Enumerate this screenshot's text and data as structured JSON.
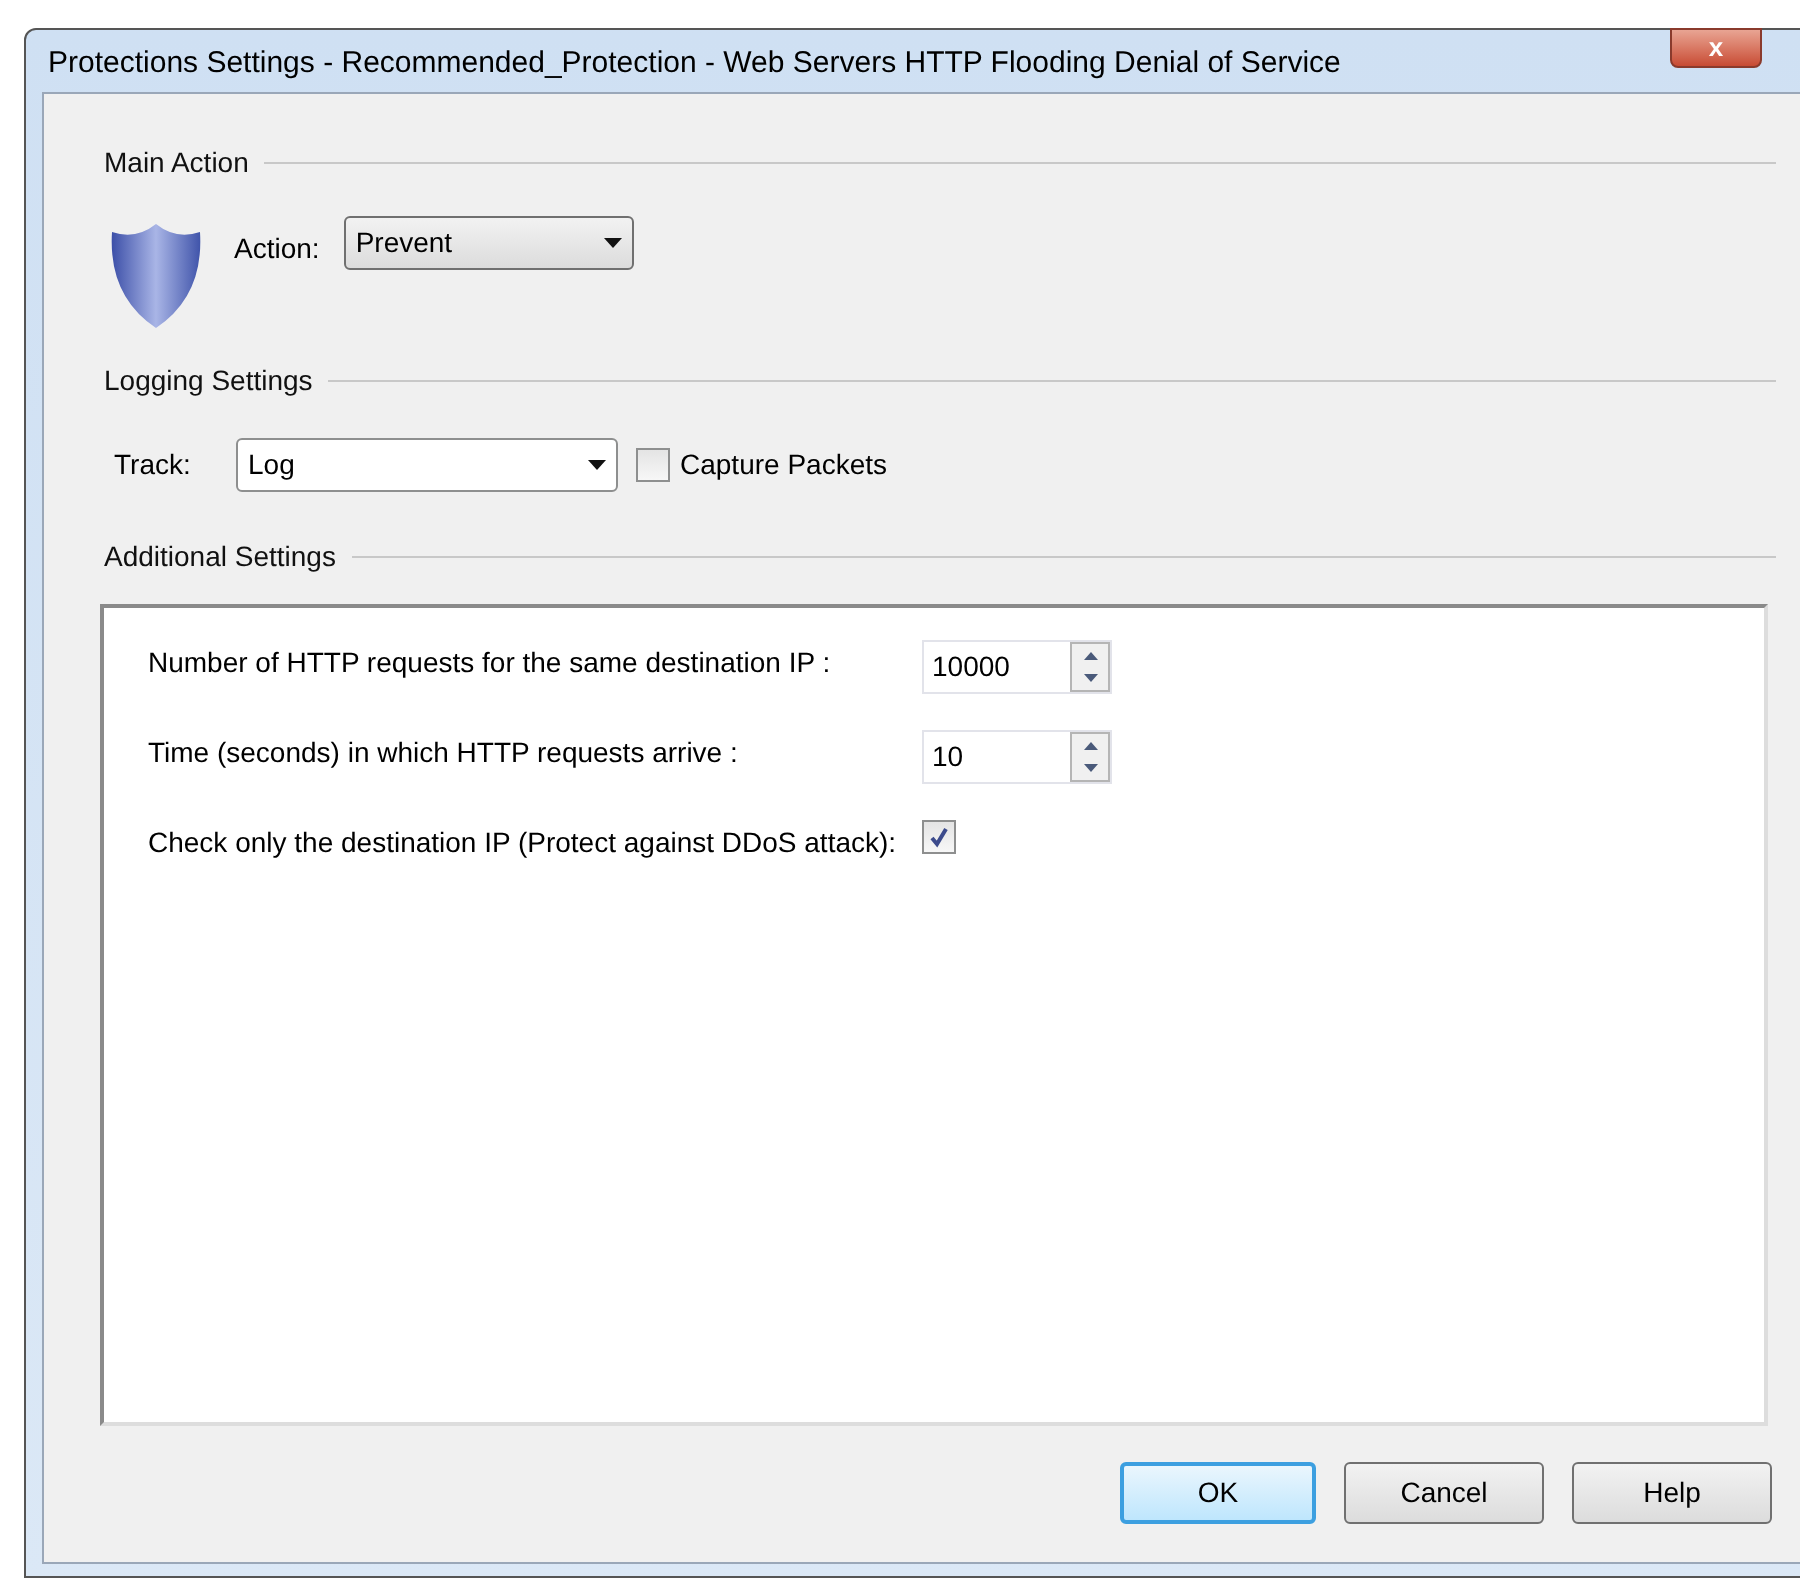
{
  "window": {
    "title": "Protections Settings - Recommended_Protection - Web Servers HTTP Flooding Denial of Service",
    "close": "x"
  },
  "main_action": {
    "heading": "Main Action",
    "label": "Action:",
    "value": "Prevent"
  },
  "logging": {
    "heading": "Logging Settings",
    "label": "Track:",
    "value": "Log",
    "capture": {
      "label": "Capture Packets",
      "checked": false
    }
  },
  "additional": {
    "heading": "Additional Settings",
    "items": [
      {
        "kind": "spin",
        "label": "Number of HTTP requests for the same destination IP :",
        "value": "10000"
      },
      {
        "kind": "spin",
        "label": "Time (seconds) in which HTTP requests arrive :",
        "value": "10"
      },
      {
        "kind": "check",
        "label": "Check only the destination IP (Protect against DDoS attack):",
        "checked": true
      }
    ]
  },
  "buttons": [
    {
      "label": "OK",
      "default": true
    },
    {
      "label": "Cancel",
      "default": false
    },
    {
      "label": "Help",
      "default": false
    }
  ]
}
